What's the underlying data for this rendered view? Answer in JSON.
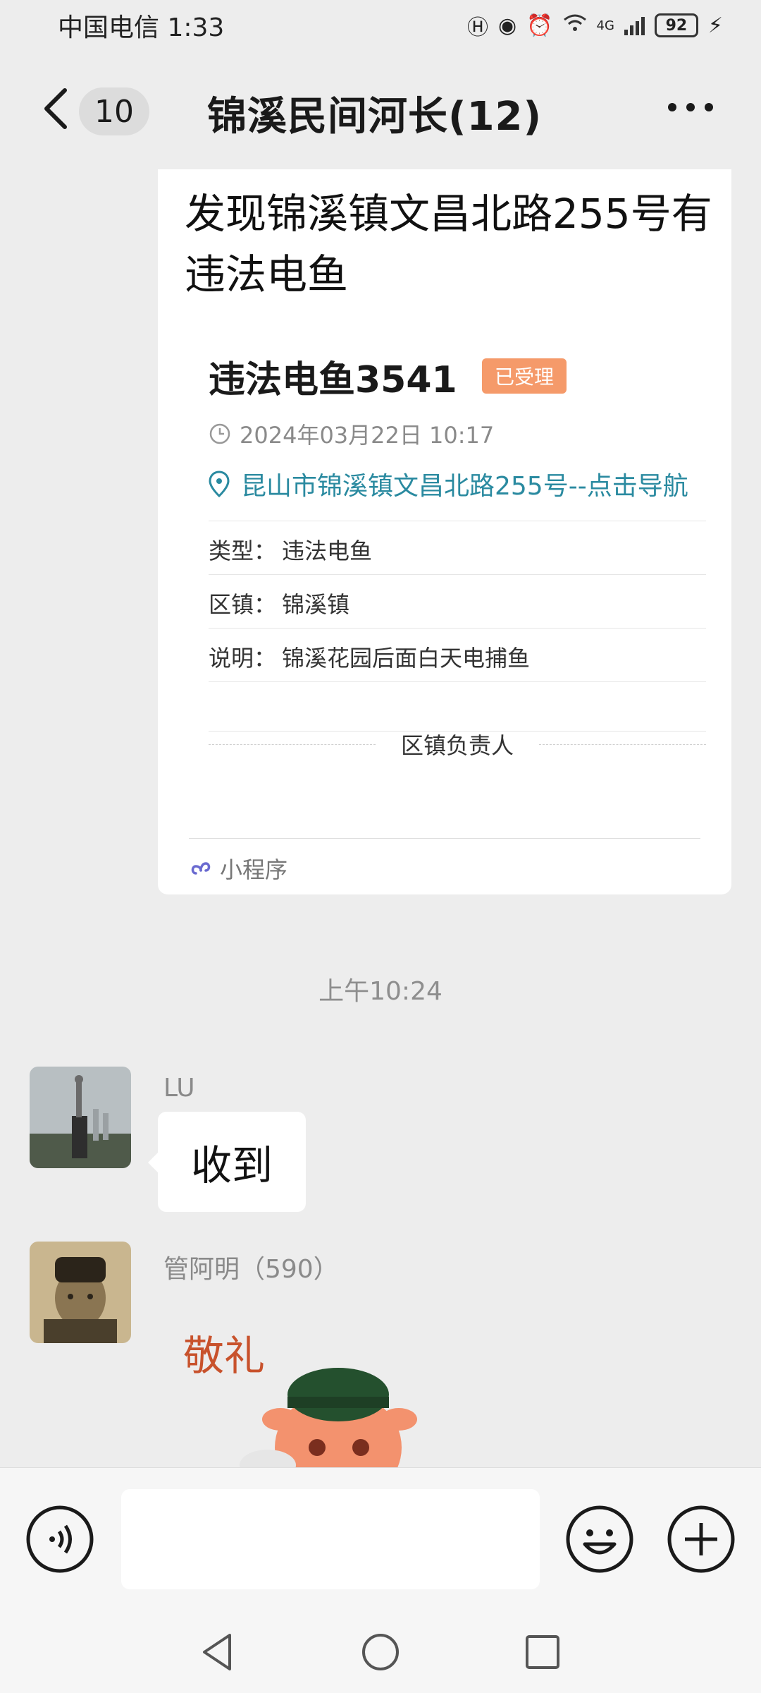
{
  "status_bar": {
    "carrier_time": "中国电信 1:33",
    "network": "4G",
    "battery": "92"
  },
  "header": {
    "unread_count": "10",
    "title": "锦溪民间河长(12)"
  },
  "card": {
    "headline": "发现锦溪镇文昌北路255号有违法电鱼",
    "inner_title": "违法电鱼3541",
    "status_tag": "已受理",
    "datetime": "2024年03月22日 10:17",
    "address": "昆山市锦溪镇文昌北路255号--点击导航",
    "fields": [
      {
        "key": "类型：",
        "value": "违法电鱼"
      },
      {
        "key": "区镇：",
        "value": "锦溪镇"
      },
      {
        "key": "说明：",
        "value": "锦溪花园后面白天电捕鱼"
      }
    ],
    "responsible": "区镇负责人",
    "mini_program": "小程序"
  },
  "timestamp": "上午10:24",
  "messages": [
    {
      "sender": "LU",
      "text": "收到"
    },
    {
      "sender": "管阿明（590）",
      "sticker_text": "敬礼"
    }
  ],
  "colors": {
    "background": "#ededed",
    "tag": "#f59a6a",
    "link": "#2a8aa0"
  },
  "icons": [
    "back-icon",
    "more-icon",
    "clock-icon",
    "location-icon",
    "mini-program-icon",
    "voice-icon",
    "emoji-icon",
    "plus-icon",
    "nav-back-icon",
    "nav-home-icon",
    "nav-recent-icon"
  ]
}
